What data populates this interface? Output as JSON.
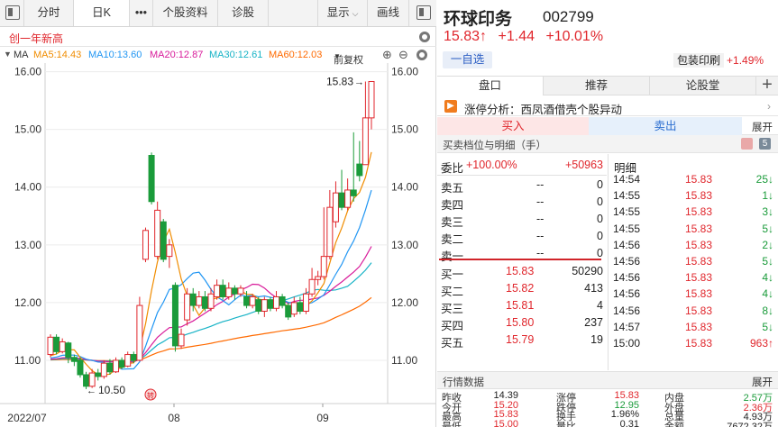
{
  "toolbar": {
    "tabs": [
      "分时",
      "日K",
      "•••",
      "个股资料",
      "诊股"
    ],
    "display": "显示",
    "draw": "画线"
  },
  "new_high_label": "创一年新高",
  "ma": {
    "label": "MA",
    "ma5": "MA5:14.43",
    "ma10": "MA10:13.60",
    "ma20": "MA20:12.87",
    "ma30": "MA30:12.61",
    "ma60": "MA60:12.03",
    "adjust": "前复权",
    "colors": {
      "ma5": "#f08c00",
      "ma10": "#2196f3",
      "ma20": "#d81b9a",
      "ma30": "#17b3c6",
      "ma60": "#ff6a00"
    }
  },
  "chart_data": {
    "type": "candlestick",
    "y_ticks": [
      "16.00",
      "15.00",
      "14.00",
      "13.00",
      "12.00",
      "11.00"
    ],
    "x_ticks": [
      "2022/07",
      "08",
      "09"
    ],
    "ylim": [
      10.25,
      16.15
    ],
    "high_annotation": "15.83",
    "low_annotation": "10.50",
    "marker": "转",
    "candles": [
      {
        "o": 11.1,
        "c": 11.4,
        "h": 11.45,
        "l": 11.05
      },
      {
        "o": 11.4,
        "c": 11.15,
        "h": 11.45,
        "l": 11.1
      },
      {
        "o": 11.15,
        "c": 11.32,
        "h": 11.38,
        "l": 11.12
      },
      {
        "o": 11.3,
        "c": 11.05,
        "h": 11.32,
        "l": 10.95
      },
      {
        "o": 11.05,
        "c": 10.98,
        "h": 11.1,
        "l": 10.9
      },
      {
        "o": 11.0,
        "c": 10.75,
        "h": 11.05,
        "l": 10.7
      },
      {
        "o": 10.75,
        "c": 10.55,
        "h": 10.8,
        "l": 10.5
      },
      {
        "o": 10.55,
        "c": 10.78,
        "h": 10.85,
        "l": 10.52
      },
      {
        "o": 10.78,
        "c": 10.72,
        "h": 10.85,
        "l": 10.65
      },
      {
        "o": 10.72,
        "c": 10.95,
        "h": 11.0,
        "l": 10.68
      },
      {
        "o": 10.95,
        "c": 10.8,
        "h": 11.02,
        "l": 10.75
      },
      {
        "o": 10.8,
        "c": 11.0,
        "h": 11.05,
        "l": 10.78
      },
      {
        "o": 11.0,
        "c": 10.88,
        "h": 11.05,
        "l": 10.85
      },
      {
        "o": 10.9,
        "c": 11.1,
        "h": 11.15,
        "l": 10.88
      },
      {
        "o": 11.1,
        "c": 11.0,
        "h": 11.15,
        "l": 10.95
      },
      {
        "o": 11.0,
        "c": 11.95,
        "h": 12.1,
        "l": 10.98
      },
      {
        "o": 12.75,
        "c": 13.25,
        "h": 13.3,
        "l": 12.7
      },
      {
        "o": 14.55,
        "c": 13.75,
        "h": 14.6,
        "l": 13.7
      },
      {
        "o": 12.8,
        "c": 13.6,
        "h": 13.75,
        "l": 12.75
      },
      {
        "o": 13.4,
        "c": 12.75,
        "h": 13.45,
        "l": 12.7
      },
      {
        "o": 12.8,
        "c": 13.0,
        "h": 13.1,
        "l": 12.6
      },
      {
        "o": 12.3,
        "c": 11.25,
        "h": 12.35,
        "l": 11.15
      },
      {
        "o": 11.25,
        "c": 11.45,
        "h": 11.55,
        "l": 11.2
      },
      {
        "o": 11.7,
        "c": 12.15,
        "h": 12.25,
        "l": 11.6
      },
      {
        "o": 12.15,
        "c": 11.95,
        "h": 12.25,
        "l": 11.85
      },
      {
        "o": 11.95,
        "c": 12.1,
        "h": 12.2,
        "l": 11.9
      },
      {
        "o": 12.1,
        "c": 11.9,
        "h": 12.2,
        "l": 11.85
      },
      {
        "o": 11.9,
        "c": 12.15,
        "h": 12.25,
        "l": 11.85
      },
      {
        "o": 12.1,
        "c": 12.3,
        "h": 12.4,
        "l": 12.05
      },
      {
        "o": 12.3,
        "c": 12.1,
        "h": 12.4,
        "l": 12.05
      },
      {
        "o": 12.1,
        "c": 12.25,
        "h": 12.35,
        "l": 12.05
      },
      {
        "o": 12.25,
        "c": 12.15,
        "h": 12.3,
        "l": 12.05
      },
      {
        "o": 12.15,
        "c": 12.25,
        "h": 12.3,
        "l": 12.1
      },
      {
        "o": 12.1,
        "c": 11.95,
        "h": 12.2,
        "l": 11.9
      },
      {
        "o": 11.95,
        "c": 12.1,
        "h": 12.15,
        "l": 11.9
      },
      {
        "o": 12.05,
        "c": 11.85,
        "h": 12.1,
        "l": 11.8
      },
      {
        "o": 11.85,
        "c": 12.05,
        "h": 12.1,
        "l": 11.75
      },
      {
        "o": 12.05,
        "c": 11.9,
        "h": 12.1,
        "l": 11.85
      },
      {
        "o": 11.9,
        "c": 12.1,
        "h": 12.2,
        "l": 11.85
      },
      {
        "o": 12.1,
        "c": 11.95,
        "h": 12.15,
        "l": 11.9
      },
      {
        "o": 11.95,
        "c": 11.75,
        "h": 12.0,
        "l": 11.7
      },
      {
        "o": 11.8,
        "c": 12.0,
        "h": 12.1,
        "l": 11.75
      },
      {
        "o": 12.0,
        "c": 11.85,
        "h": 12.1,
        "l": 11.8
      },
      {
        "o": 11.85,
        "c": 12.15,
        "h": 12.25,
        "l": 11.8
      },
      {
        "o": 12.15,
        "c": 12.4,
        "h": 12.6,
        "l": 12.1
      },
      {
        "o": 12.4,
        "c": 12.45,
        "h": 12.55,
        "l": 12.3
      },
      {
        "o": 12.45,
        "c": 12.8,
        "h": 13.65,
        "l": 12.4
      },
      {
        "o": 12.8,
        "c": 13.65,
        "h": 13.95,
        "l": 12.75
      },
      {
        "o": 13.4,
        "c": 13.9,
        "h": 14.1,
        "l": 13.3
      },
      {
        "o": 13.9,
        "c": 13.65,
        "h": 14.3,
        "l": 13.6
      },
      {
        "o": 13.65,
        "c": 13.95,
        "h": 14.15,
        "l": 13.6
      },
      {
        "o": 13.95,
        "c": 13.85,
        "h": 14.95,
        "l": 13.75
      },
      {
        "o": 14.4,
        "c": 14.2,
        "h": 14.8,
        "l": 14.1
      },
      {
        "o": 14.39,
        "c": 15.2,
        "h": 15.83,
        "l": 15.0
      },
      {
        "o": 15.2,
        "c": 15.83,
        "h": 15.83,
        "l": 15.0
      }
    ]
  },
  "stock": {
    "name": "环球印务",
    "code": "002799",
    "price": "15.83↑",
    "change": "+1.44",
    "change_pct": "+10.01%",
    "self_select": "一自选",
    "sector_name": "包装印刷",
    "sector_pct": "+1.49%"
  },
  "tabs": [
    "盘口",
    "推荐",
    "论股堂"
  ],
  "analysis": "涨停分析：西凤酒借壳个股异动",
  "buy_label": "买入",
  "sell_label": "卖出",
  "expand_label": "展开",
  "detail_header": "买卖档位与明细（手）",
  "badge_num": "5",
  "weibi": {
    "label": "委比",
    "pct": "+100.00%",
    "value": "+50963"
  },
  "asks": [
    {
      "label": "卖五",
      "price": "--",
      "vol": "0"
    },
    {
      "label": "卖四",
      "price": "--",
      "vol": "0"
    },
    {
      "label": "卖三",
      "price": "--",
      "vol": "0"
    },
    {
      "label": "卖二",
      "price": "--",
      "vol": "0"
    },
    {
      "label": "卖一",
      "price": "--",
      "vol": "0"
    }
  ],
  "bids": [
    {
      "label": "买一",
      "price": "15.83",
      "vol": "50290"
    },
    {
      "label": "买二",
      "price": "15.82",
      "vol": "413"
    },
    {
      "label": "买三",
      "price": "15.81",
      "vol": "4"
    },
    {
      "label": "买四",
      "price": "15.80",
      "vol": "237"
    },
    {
      "label": "买五",
      "price": "15.79",
      "vol": "19"
    }
  ],
  "ticks_title": "明细",
  "ticks": [
    {
      "time": "14:54",
      "price": "15.83",
      "vol": "25↓",
      "dir": "down"
    },
    {
      "time": "14:55",
      "price": "15.83",
      "vol": "1↓",
      "dir": "down"
    },
    {
      "time": "14:55",
      "price": "15.83",
      "vol": "3↓",
      "dir": "down"
    },
    {
      "time": "14:55",
      "price": "15.83",
      "vol": "5↓",
      "dir": "down"
    },
    {
      "time": "14:56",
      "price": "15.83",
      "vol": "2↓",
      "dir": "down"
    },
    {
      "time": "14:56",
      "price": "15.83",
      "vol": "5↓",
      "dir": "down"
    },
    {
      "time": "14:56",
      "price": "15.83",
      "vol": "4↓",
      "dir": "down"
    },
    {
      "time": "14:56",
      "price": "15.83",
      "vol": "4↓",
      "dir": "down"
    },
    {
      "time": "14:56",
      "price": "15.83",
      "vol": "8↓",
      "dir": "down"
    },
    {
      "time": "14:57",
      "price": "15.83",
      "vol": "5↓",
      "dir": "down"
    },
    {
      "time": "15:00",
      "price": "15.83",
      "vol": "963↑",
      "dir": "up"
    }
  ],
  "stats_header": "行情数据",
  "stats": [
    [
      {
        "k": "昨收",
        "v": "14.39",
        "c": "dark"
      },
      {
        "k": "涨停",
        "v": "15.83",
        "c": "red"
      },
      {
        "k": "内盘",
        "v": "2.57万",
        "c": "green"
      }
    ],
    [
      {
        "k": "今开",
        "v": "15.20",
        "c": "red"
      },
      {
        "k": "跌停",
        "v": "12.95",
        "c": "green"
      },
      {
        "k": "外盘",
        "v": "2.36万",
        "c": "red"
      }
    ],
    [
      {
        "k": "最高",
        "v": "15.83",
        "c": "red"
      },
      {
        "k": "换手",
        "v": "1.96%",
        "c": "dark"
      },
      {
        "k": "总量",
        "v": "4.93万",
        "c": "dark"
      }
    ],
    [
      {
        "k": "最低",
        "v": "15.00",
        "c": "red"
      },
      {
        "k": "量比",
        "v": "0.31",
        "c": "dark"
      },
      {
        "k": "金额",
        "v": "7672.32万",
        "c": "dark"
      }
    ]
  ]
}
